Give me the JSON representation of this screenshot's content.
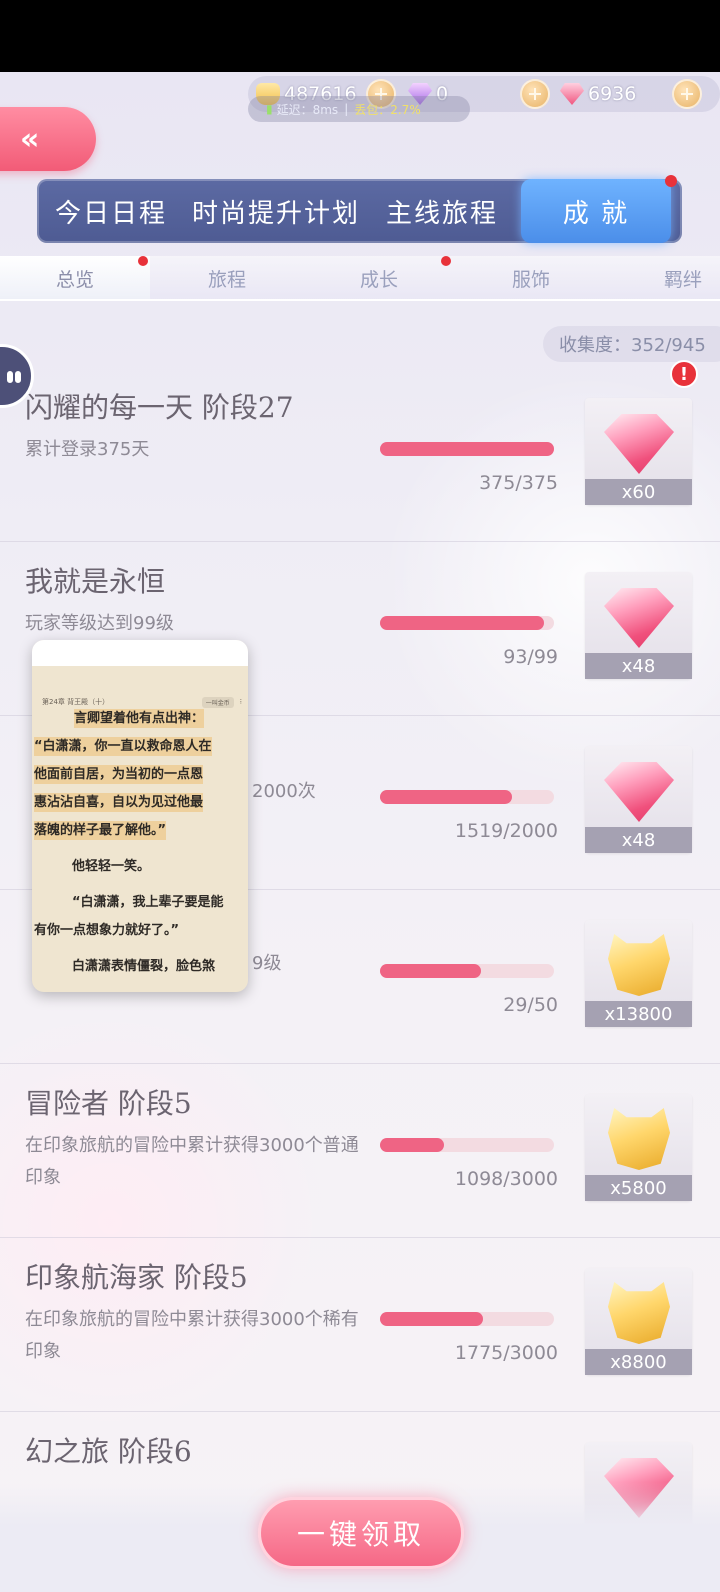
{
  "currency": {
    "coins": "487616",
    "purple_gems": "0",
    "pink_gems": "6936"
  },
  "status": {
    "latency_label": "延迟：8ms",
    "packet_loss_label": "丢包：2.7%"
  },
  "main_tabs": [
    {
      "label": "今日日程"
    },
    {
      "label": "时尚提升计划"
    },
    {
      "label": "主线旅程"
    },
    {
      "label": "成 就"
    }
  ],
  "sub_tabs": [
    {
      "label": "总览"
    },
    {
      "label": "旅程"
    },
    {
      "label": "成长"
    },
    {
      "label": "服饰"
    },
    {
      "label": "羁绊"
    }
  ],
  "collection": "收集度：352/945",
  "achievements": [
    {
      "title": "闪耀的每一天 阶段27",
      "desc": "累计登录375天",
      "progress": "375/375",
      "fraction": 1.0,
      "reward_type": "diamond",
      "reward_count": "x60",
      "alert": "!"
    },
    {
      "title": "我就是永恒",
      "desc": "玩家等级达到99级",
      "progress": "93/99",
      "fraction": 0.94,
      "reward_type": "diamond",
      "reward_count": "x48"
    },
    {
      "title": "",
      "desc": "2000次",
      "progress": "1519/2000",
      "fraction": 0.76,
      "reward_type": "diamond",
      "reward_count": "x48"
    },
    {
      "title": "",
      "desc": "9级",
      "progress": "29/50",
      "fraction": 0.58,
      "reward_type": "coin",
      "reward_count": "x13800"
    },
    {
      "title": "冒险者 阶段5",
      "desc": "在印象旅航的冒险中累计获得3000个普通印象",
      "progress": "1098/3000",
      "fraction": 0.366,
      "reward_type": "coin",
      "reward_count": "x5800"
    },
    {
      "title": "印象航海家 阶段5",
      "desc": "在印象旅航的冒险中累计获得3000个稀有印象",
      "progress": "1775/3000",
      "fraction": 0.59,
      "reward_type": "coin",
      "reward_count": "x8800"
    },
    {
      "title": "幻之旅 阶段6",
      "desc": "",
      "progress": "",
      "fraction": 0,
      "reward_type": "diamond",
      "reward_count": ""
    }
  ],
  "reader": {
    "chapter": "第24章 背王殿（十）",
    "button": "一叫金币",
    "p1": "言卿望着他有点出神：",
    "p2a": "“白潇潇，你一直以救命恩人在",
    "p2b": "他面前自居，为当初的一点恩",
    "p2c": "惠沾沾自喜，自以为见过他最",
    "p2d": "落魄的样子最了解他。”",
    "p3": "他轻轻一笑。",
    "p4a": "“白潇潇，我上辈子要是能",
    "p4b": "有你一点想象力就好了。”",
    "p5": "白潇潇表情僵裂，脸色煞"
  },
  "claim_button": "一键领取",
  "colors": {
    "accent_pink": "#ef6484",
    "tab_blue": "#4b8ee9",
    "alert_red": "#e8323a"
  }
}
